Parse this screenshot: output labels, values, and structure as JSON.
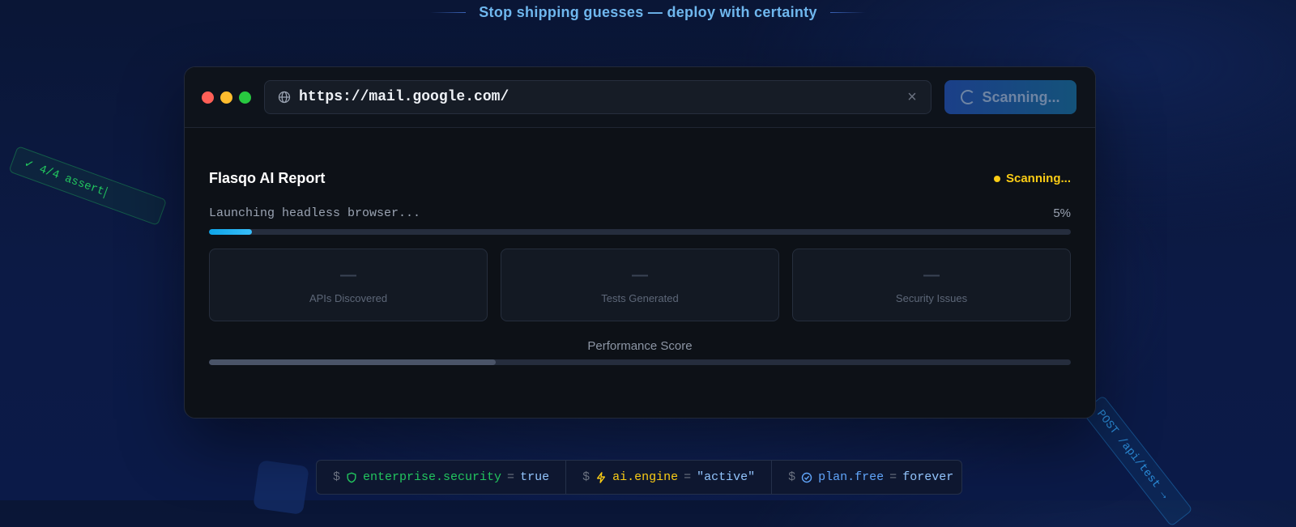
{
  "tagline": "Stop shipping guesses — deploy with certainty",
  "floating": {
    "left_chip": "✓ 4/4 assert",
    "right_chip": "POST /api/test →"
  },
  "window": {
    "url": "https://mail.google.com/",
    "scan_button_label": "Scanning...",
    "report_title": "Flasqo AI Report",
    "status_label": "Scanning...",
    "progress_message": "Launching headless browser...",
    "progress_percent_label": "5%",
    "progress_value": 0.05,
    "stats": [
      {
        "value": "—",
        "label": "APIs Discovered"
      },
      {
        "value": "—",
        "label": "Tests Generated"
      },
      {
        "value": "—",
        "label": "Security Issues"
      }
    ],
    "performance_label": "Performance Score",
    "performance_value": 0.333
  },
  "config_bar": [
    {
      "prompt": "$",
      "icon": "shield-icon",
      "key": "enterprise.security",
      "value": "true",
      "key_color": "#22c55e"
    },
    {
      "prompt": "$",
      "icon": "lightning-icon",
      "key": "ai.engine",
      "value": "\"active\"",
      "key_color": "#facc15"
    },
    {
      "prompt": "$",
      "icon": "check-circle-icon",
      "key": "plan.free",
      "value": "forever",
      "key_color": "#60a5fa"
    }
  ],
  "colors": {
    "accent": "#38bdf8",
    "status_yellow": "#facc15",
    "success_green": "#22c55e"
  }
}
